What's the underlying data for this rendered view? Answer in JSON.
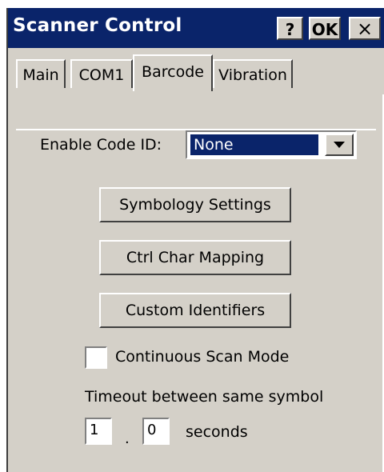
{
  "window": {
    "title": "Scanner Control",
    "help_label": "?",
    "ok_label": "OK",
    "close_label": "×"
  },
  "tabs": [
    {
      "label": "Main",
      "selected": false
    },
    {
      "label": "COM1",
      "selected": false
    },
    {
      "label": "Barcode",
      "selected": true
    },
    {
      "label": "Vibration",
      "selected": false
    }
  ],
  "form": {
    "enable_code_id_label": "Enable Code ID:",
    "enable_code_id_value": "None",
    "buttons": {
      "symbology": "Symbology Settings",
      "ctrl_char": "Ctrl Char Mapping",
      "custom_ids": "Custom Identifiers"
    },
    "continuous_scan_label": "Continuous Scan Mode",
    "continuous_scan_checked": false,
    "timeout_label": "Timeout between same symbol",
    "timeout_whole": "1",
    "timeout_separator": ".",
    "timeout_fraction": "0",
    "timeout_unit": "seconds"
  },
  "colors": {
    "titlebar": "#0a246a",
    "face": "#d4d0c8",
    "selection": "#0a246a"
  },
  "icons": {
    "dropdown": "chevron-down-icon"
  }
}
